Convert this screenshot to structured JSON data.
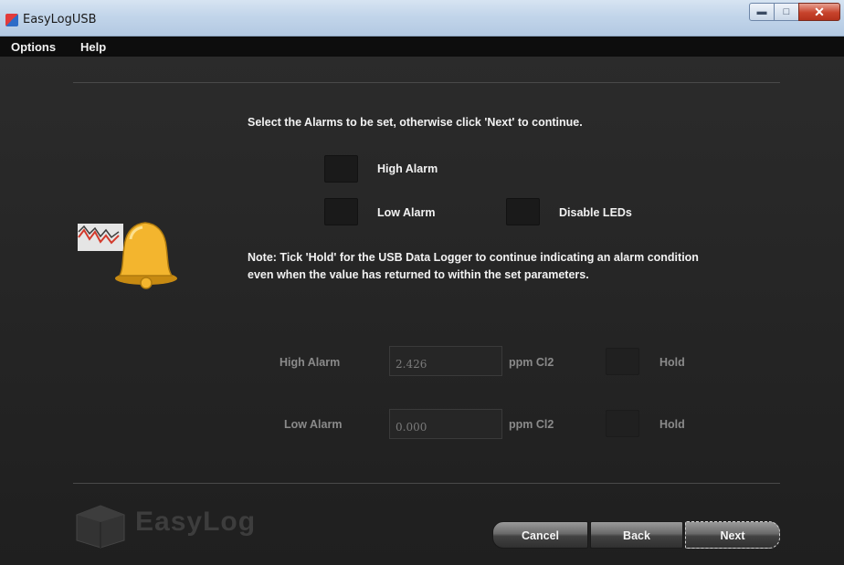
{
  "window": {
    "title": "EasyLogUSB"
  },
  "menu": {
    "items": [
      {
        "label": "Options"
      },
      {
        "label": "Help"
      }
    ]
  },
  "instructions": "Select the Alarms to be set, otherwise click 'Next' to continue.",
  "alarm_options": {
    "high_alarm_label": "High Alarm",
    "low_alarm_label": "Low Alarm",
    "disable_leds_label": "Disable LEDs"
  },
  "note": {
    "line1": "Note: Tick 'Hold' for the USB Data Logger to continue indicating an alarm condition",
    "line2": "even when the value has returned to within the set parameters."
  },
  "thresholds": {
    "high": {
      "label": "High Alarm",
      "value": "2.426",
      "unit": "ppm Cl2",
      "hold_label": "Hold"
    },
    "low": {
      "label": "Low Alarm",
      "value": "0.000",
      "unit": "ppm Cl2",
      "hold_label": "Hold"
    }
  },
  "logo": {
    "text": "EasyLog",
    "icon": "easylog-cube-logo"
  },
  "illustration": {
    "icon": "alarm-bell-icon"
  },
  "buttons": {
    "cancel": "Cancel",
    "back": "Back",
    "next": "Next"
  },
  "colors": {
    "background": "#222222",
    "text": "#f2f2f2",
    "bell": "#f3b52e"
  }
}
